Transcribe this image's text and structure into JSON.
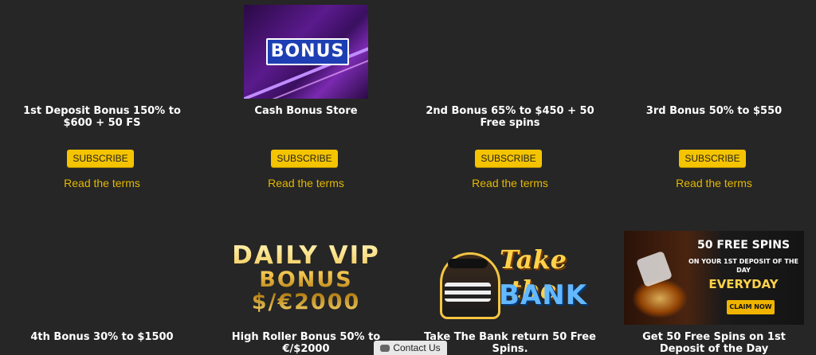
{
  "colors": {
    "background": "#262626",
    "accent": "#f5c400",
    "link": "#e4b800"
  },
  "cards": [
    {
      "pct": "150",
      "pct_sign": "%",
      "currency": "$",
      "amount": "600",
      "title": "1st Deposit Bonus 150% to $600 + 50 FS",
      "button": "SUBSCRIBE",
      "terms": "Read the terms"
    },
    {
      "image_text": "BONUS",
      "title": "Cash Bonus Store",
      "button": "SUBSCRIBE",
      "terms": "Read the terms"
    },
    {
      "pct": "65",
      "pct_sign": "%",
      "currency": "$",
      "amount": "450",
      "title": "2nd Bonus 65% to $450 + 50 Free spins",
      "button": "SUBSCRIBE",
      "terms": "Read the terms"
    },
    {
      "pct": "50",
      "pct_sign": "%",
      "currency": "$",
      "amount": "550",
      "title": "3rd Bonus 50% to $550",
      "button": "SUBSCRIBE",
      "terms": "Read the terms"
    },
    {
      "pct": "30",
      "pct_sign": "%",
      "currency": "$",
      "amount": "1500",
      "title": "4th Bonus 30% to $1500"
    },
    {
      "image_line1": "DAILY VIP",
      "image_line2": "BONUS",
      "image_line3": "$/€2000",
      "title": "High Roller Bonus 50% to €/$2000"
    },
    {
      "image_line1": "Take the",
      "image_line2": "BANK",
      "title": "Take The Bank return 50 Free Spins."
    },
    {
      "image_headline": "50 FREE SPINS",
      "image_sub": "ON YOUR 1ST DEPOSIT OF THE DAY",
      "image_emph": "EVERYDAY",
      "image_button": "CLAIM NOW",
      "title": "Get 50 Free Spins on 1st Deposit of the Day"
    }
  ],
  "contact": {
    "label": "Contact Us",
    "icon": "chat-icon"
  }
}
